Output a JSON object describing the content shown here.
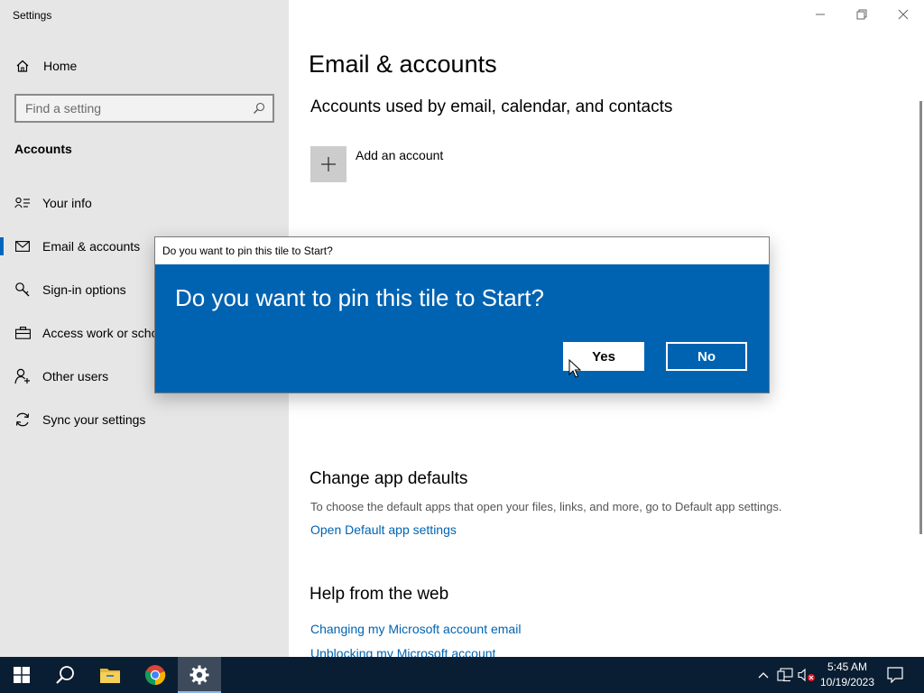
{
  "window": {
    "title": "Settings"
  },
  "sidebar": {
    "home_label": "Home",
    "search_placeholder": "Find a setting",
    "section_heading": "Accounts",
    "items": [
      {
        "label": "Your info",
        "icon": "person-card-icon"
      },
      {
        "label": "Email & accounts",
        "icon": "mail-icon",
        "active": true
      },
      {
        "label": "Sign-in options",
        "icon": "key-icon"
      },
      {
        "label": "Access work or school",
        "icon": "briefcase-icon"
      },
      {
        "label": "Other users",
        "icon": "add-person-icon"
      },
      {
        "label": "Sync your settings",
        "icon": "sync-icon"
      }
    ]
  },
  "main": {
    "title": "Email & accounts",
    "subtitle": "Accounts used by email, calendar, and contacts",
    "add_account_label": "Add an account",
    "change_defaults_heading": "Change app defaults",
    "change_defaults_desc": "To choose the default apps that open your files, links, and more, go to Default app settings.",
    "open_defaults_link": "Open Default app settings",
    "help_heading": "Help from the web",
    "help_links": [
      "Changing my Microsoft account email",
      "Unblocking my Microsoft account"
    ]
  },
  "dialog": {
    "title": "Do you want to pin this tile to Start?",
    "message": "Do you want to pin this tile to Start?",
    "yes_label": "Yes",
    "no_label": "No"
  },
  "taskbar": {
    "time": "5:45 AM",
    "date": "10/19/2023"
  },
  "colors": {
    "accent": "#0063b1",
    "sidebar_bg": "#e6e6e6",
    "taskbar_bg": "#0a1e33"
  }
}
